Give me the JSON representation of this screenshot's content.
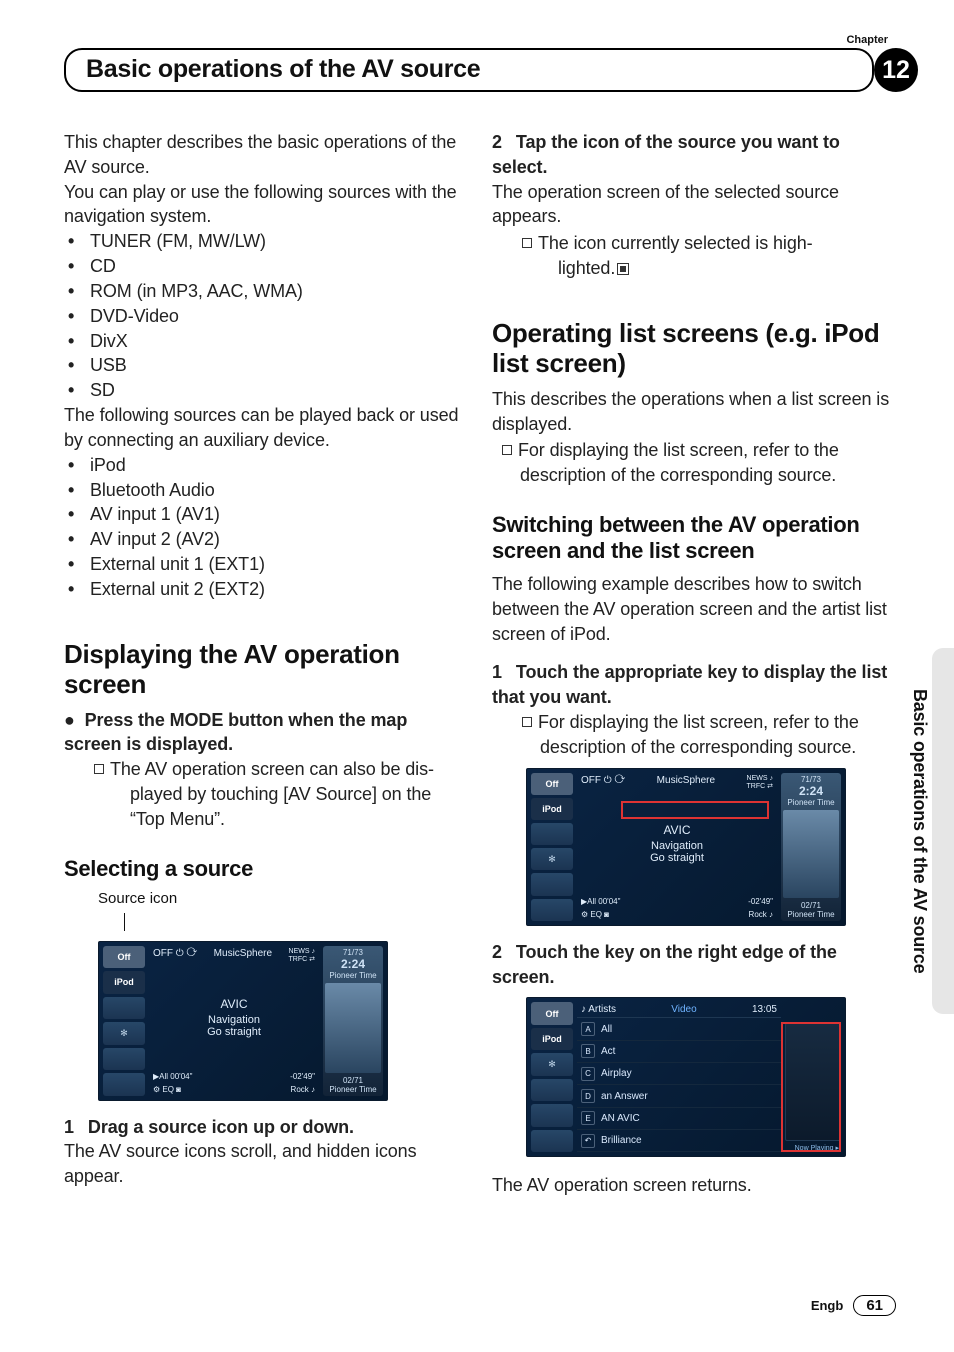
{
  "chapter_label": "Chapter",
  "page_title": "Basic operations of the AV source",
  "chapter_number": "12",
  "side_tab_text": "Basic operations of the AV source",
  "left": {
    "intro_1": "This chapter describes the basic operations of the AV source.",
    "intro_2": "You can play or use the following sources with the navigation system.",
    "bullets_a": [
      "TUNER (FM, MW/LW)",
      "CD",
      "ROM (in MP3, AAC, WMA)",
      "DVD-Video",
      "DivX",
      "USB",
      "SD"
    ],
    "intro_3": "The following sources can be played back or used by connecting an auxiliary device.",
    "bullets_b": [
      "iPod",
      "Bluetooth Audio",
      "AV input 1 (AV1)",
      "AV input 2 (AV2)",
      "External unit 1 (EXT1)",
      "External unit 2 (EXT2)"
    ],
    "h2_a": "Displaying the AV operation screen",
    "bullet_step_prefix": "●",
    "bullet_step": "Press the MODE button when the map screen is displayed.",
    "note_a_1": "The AV operation screen can also be dis-",
    "note_a_2": "played by touching [",
    "note_a_bold1": "AV Source",
    "note_a_3": "] on the",
    "note_a_4": "“",
    "note_a_bold2": "Top Menu",
    "note_a_5": "”.",
    "h3_a": "Selecting a source",
    "fig1_caption": "Source icon",
    "fig1": {
      "side": [
        "Off",
        "iPod",
        "",
        "",
        "",
        ""
      ],
      "top_left": "OFF ⏻   ⟳",
      "top_mid": "MusicSphere",
      "top_right": "NEWS ♪\nTRFC ⇄",
      "time": "2:24",
      "trackno": "71/73",
      "pt": "Pioneer Time",
      "center1": "AVIC",
      "center2": "Navigation",
      "center3": "Go straight",
      "bot_left": "▶All 00'04\"",
      "bot_right": "-02'49\"",
      "foot_left": "⚙  EQ  ◙",
      "foot_right": "Rock ♪",
      "foot_num": "02/71",
      "foot_pt": "Pioneer Time"
    },
    "step1_num": "1",
    "step1": "Drag a source icon up or down.",
    "step1_body": "The AV source icons scroll, and hidden icons appear."
  },
  "right": {
    "step2_num": "2",
    "step2": "Tap the icon of the source you want to select.",
    "step2_body": "The operation screen of the selected source appears.",
    "note2_1": "The icon currently selected is high-",
    "note2_2": "lighted.",
    "h2_b": "Operating list screens (e.g. iPod list screen)",
    "desc_b": "This describes the operations when a list screen is displayed.",
    "note_b": "For displaying the list screen, refer to the description of the corresponding source.",
    "h3_b": "Switching between the AV operation screen and the list screen",
    "desc_c": "The following example describes how to switch between the AV operation screen and the artist list screen of iPod.",
    "stepc1_num": "1",
    "stepc1": "Touch the appropriate key to display the list that you want.",
    "note_c": "For displaying the list screen, refer to the description of the corresponding source.",
    "stepc2_num": "2",
    "stepc2": "Touch the key on the right edge of the screen.",
    "fig3": {
      "head_left": "♪  Artists",
      "head_mid": "Video",
      "head_right": "13:05",
      "rows": [
        {
          "k": "A",
          "t": "All"
        },
        {
          "k": "B",
          "t": "Act"
        },
        {
          "k": "C",
          "t": "Airplay"
        },
        {
          "k": "D",
          "t": "an Answer"
        },
        {
          "k": "E",
          "t": "AN AVIC"
        },
        {
          "k": "↶",
          "t": "Brilliance"
        }
      ],
      "np": "Now Playing ▸"
    },
    "closing": "The AV operation screen returns."
  },
  "footer": {
    "lang": "Engb",
    "page": "61"
  }
}
